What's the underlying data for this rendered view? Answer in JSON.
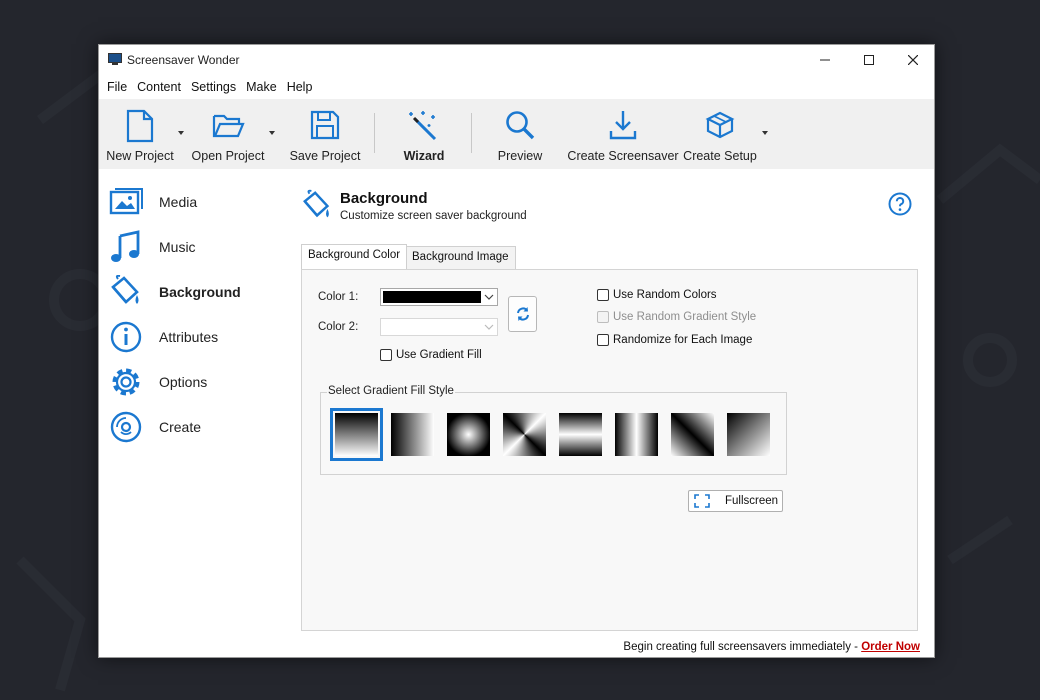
{
  "window": {
    "title": "Screensaver Wonder"
  },
  "menu": [
    "File",
    "Content",
    "Settings",
    "Make",
    "Help"
  ],
  "toolbar": {
    "new_project": "New Project",
    "open_project": "Open Project",
    "save_project": "Save Project",
    "wizard": "Wizard",
    "preview": "Preview",
    "create_screensaver": "Create Screensaver",
    "create_setup": "Create Setup"
  },
  "sidebar": {
    "items": [
      {
        "label": "Media",
        "icon": "media-icon"
      },
      {
        "label": "Music",
        "icon": "music-icon"
      },
      {
        "label": "Background",
        "icon": "paint-bucket-icon",
        "active": true
      },
      {
        "label": "Attributes",
        "icon": "info-icon"
      },
      {
        "label": "Options",
        "icon": "gear-icon"
      },
      {
        "label": "Create",
        "icon": "disc-icon"
      }
    ]
  },
  "panel": {
    "title": "Background",
    "subtitle": "Customize screen saver background"
  },
  "tabs": [
    "Background Color",
    "Background Image"
  ],
  "color_settings": {
    "color1_label": "Color 1:",
    "color2_label": "Color 2:",
    "color1_value": "#000000",
    "use_gradient_fill": "Use Gradient Fill"
  },
  "options": {
    "use_random_colors": "Use Random Colors",
    "use_random_gradient_style": "Use Random Gradient Style",
    "randomize_each_image": "Randomize for Each Image"
  },
  "gradient_group": {
    "label": "Select Gradient Fill Style"
  },
  "fullscreen_label": "Fullscreen",
  "status": {
    "text": "Begin creating full screensavers immediately - ",
    "link": "Order Now"
  },
  "colors": {
    "accent": "#1b78d0",
    "link": "#c00000"
  }
}
